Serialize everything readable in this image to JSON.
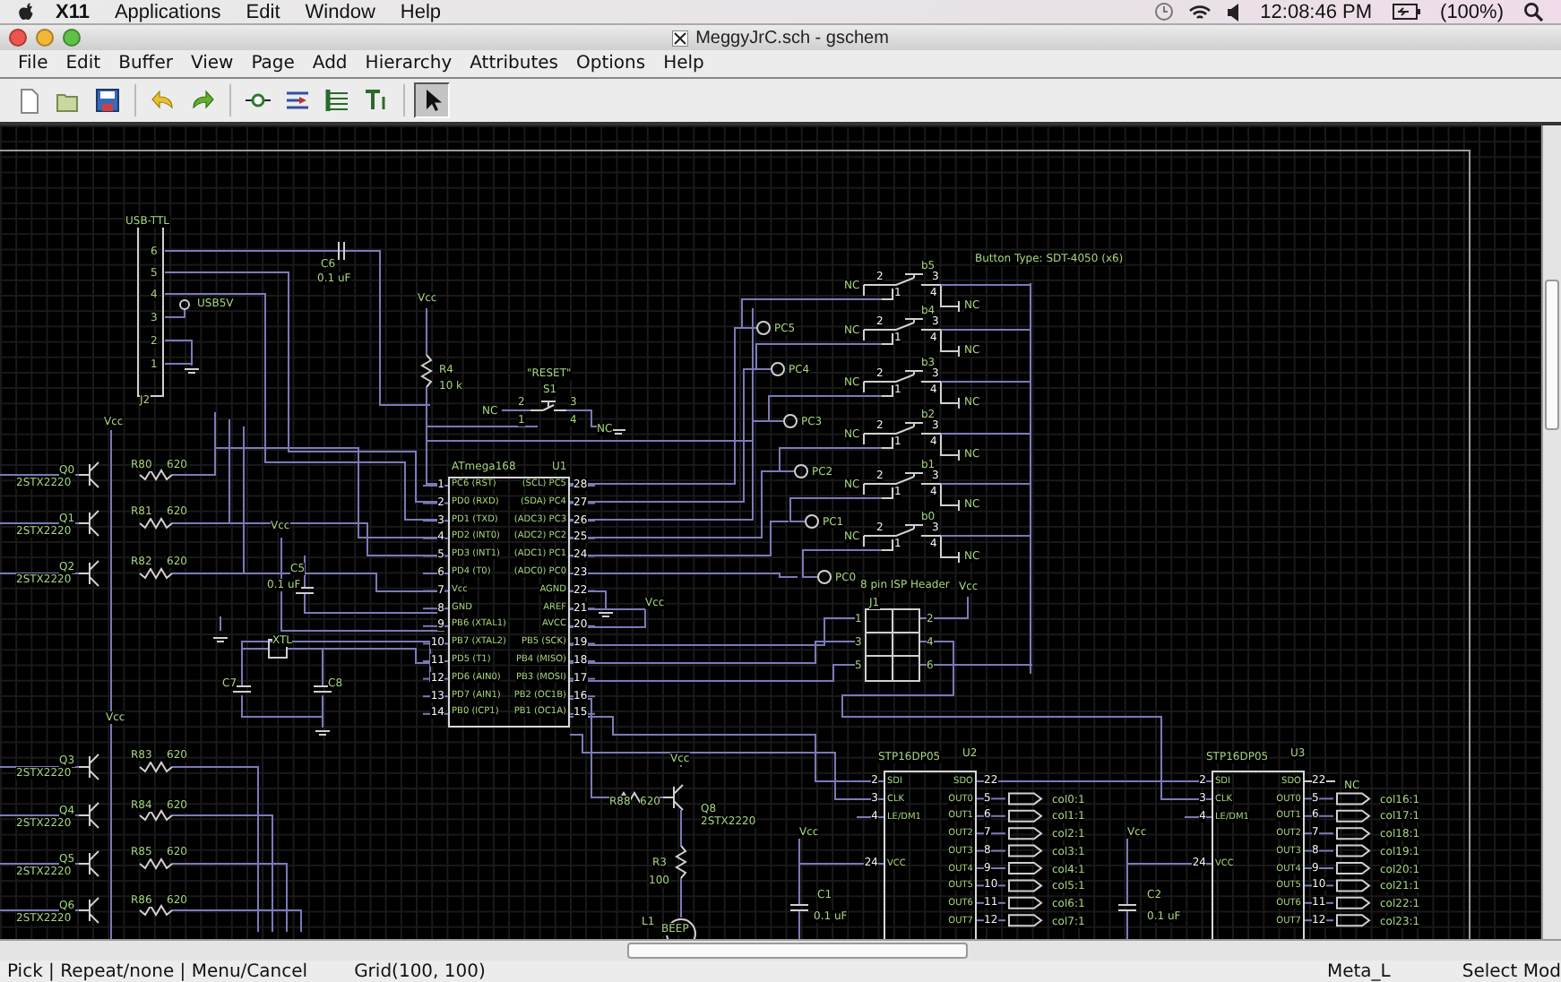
{
  "system_menubar": {
    "items": [
      "X11",
      "Applications",
      "Edit",
      "Window",
      "Help"
    ],
    "clock": "12:08:46 PM",
    "battery": "(100%)"
  },
  "window": {
    "title": "MeggyJrC.sch - gschem"
  },
  "menu": [
    "File",
    "Edit",
    "Buffer",
    "View",
    "Page",
    "Add",
    "Hierarchy",
    "Attributes",
    "Options",
    "Help"
  ],
  "toolbar": [
    {
      "kind": "new",
      "selected": false
    },
    {
      "kind": "open",
      "selected": false
    },
    {
      "kind": "save",
      "selected": false
    },
    {
      "kind": "sep"
    },
    {
      "kind": "undo",
      "selected": false
    },
    {
      "kind": "redo",
      "selected": false
    },
    {
      "kind": "sep"
    },
    {
      "kind": "component",
      "selected": false
    },
    {
      "kind": "net",
      "selected": false
    },
    {
      "kind": "bus",
      "selected": false
    },
    {
      "kind": "text",
      "selected": false
    },
    {
      "kind": "sep"
    },
    {
      "kind": "select",
      "selected": true
    }
  ],
  "schematic": {
    "labels": [
      "USB-TTL",
      "6",
      "5",
      "4",
      "3",
      "2",
      "1",
      "USB5V",
      "J2",
      "C6",
      "0.1 uF",
      "Vcc",
      "R4",
      "10 k",
      "\"RESET\"",
      "S1",
      "NC",
      "2",
      "3",
      "1",
      "4",
      "NC",
      "Vcc",
      "Q0",
      "2STX2220",
      "R80",
      "620",
      "Q1",
      "2STX2220",
      "R81",
      "620",
      "Q2",
      "2STX2220",
      "R82",
      "620",
      "Vcc",
      "C5",
      "0.1 uF",
      "XTL",
      "C7",
      "C8",
      "Vcc",
      "Q3",
      "2STX2220",
      "R83",
      "620",
      "Q4",
      "2STX2220",
      "R84",
      "620",
      "Q5",
      "2STX2220",
      "R85",
      "620",
      "Q6",
      "2STX2220",
      "R86",
      "620",
      "Vcc",
      "R88",
      "620",
      "Vcc",
      "Q8",
      "2STX2220",
      "R3",
      "100",
      "L1",
      "BEEP",
      "Button Type: SDT-4050 (x6)",
      "PC5",
      "PC4",
      "PC3",
      "PC2",
      "PC1",
      "PC0",
      "8 pin ISP Header",
      "J1",
      "Vcc",
      "1",
      "2",
      "3",
      "4",
      "5",
      "6",
      "NC",
      "Vcc",
      "C1",
      "0.1 uF",
      "Vcc",
      "C2",
      "0.1 uF"
    ],
    "switches": [
      {
        "ref": "b5",
        "pins": [
          "2",
          "1",
          "3",
          "4"
        ],
        "nc": [
          "NC",
          "NC"
        ]
      },
      {
        "ref": "b4",
        "pins": [
          "2",
          "1",
          "3",
          "4"
        ],
        "nc": [
          "NC",
          "NC"
        ]
      },
      {
        "ref": "b3",
        "pins": [
          "2",
          "1",
          "3",
          "4"
        ],
        "nc": [
          "NC",
          "NC"
        ]
      },
      {
        "ref": "b2",
        "pins": [
          "2",
          "1",
          "3",
          "4"
        ],
        "nc": [
          "NC",
          "NC"
        ]
      },
      {
        "ref": "b1",
        "pins": [
          "2",
          "1",
          "3",
          "4"
        ],
        "nc": [
          "NC",
          "NC"
        ]
      },
      {
        "ref": "b0",
        "pins": [
          "2",
          "1",
          "3",
          "4"
        ],
        "nc": [
          "NC",
          "NC"
        ]
      }
    ],
    "mcu": {
      "name": "ATmega168",
      "ref": "U1",
      "left_pins": [
        {
          "num": "1",
          "name": "PC6 (RST)"
        },
        {
          "num": "2",
          "name": "PD0 (RXD)"
        },
        {
          "num": "3",
          "name": "PD1 (TXD)"
        },
        {
          "num": "4",
          "name": "PD2 (INT0)"
        },
        {
          "num": "5",
          "name": "PD3 (INT1)"
        },
        {
          "num": "6",
          "name": "PD4 (T0)"
        },
        {
          "num": "7",
          "name": "Vcc"
        },
        {
          "num": "8",
          "name": "GND"
        },
        {
          "num": "9",
          "name": "PB6 (XTAL1)"
        },
        {
          "num": "10",
          "name": "PB7 (XTAL2)"
        },
        {
          "num": "11",
          "name": "PD5 (T1)"
        },
        {
          "num": "12",
          "name": "PD6 (AIN0)"
        },
        {
          "num": "13",
          "name": "PD7 (AIN1)"
        },
        {
          "num": "14",
          "name": "PB0 (ICP1)"
        }
      ],
      "right_pins": [
        {
          "num": "28",
          "name": "(SCL) PC5"
        },
        {
          "num": "27",
          "name": "(SDA) PC4"
        },
        {
          "num": "26",
          "name": "(ADC3) PC3"
        },
        {
          "num": "25",
          "name": "(ADC2) PC2"
        },
        {
          "num": "24",
          "name": "(ADC1) PC1"
        },
        {
          "num": "23",
          "name": "(ADC0) PC0"
        },
        {
          "num": "22",
          "name": "AGND"
        },
        {
          "num": "21",
          "name": "AREF"
        },
        {
          "num": "20",
          "name": "AVCC"
        },
        {
          "num": "19",
          "name": "PB5 (SCK)"
        },
        {
          "num": "18",
          "name": "PB4 (MISO)"
        },
        {
          "num": "17",
          "name": "PB3 (MOSI)"
        },
        {
          "num": "16",
          "name": "PB2 (OC1B)"
        },
        {
          "num": "15",
          "name": "PB1 (OC1A)"
        }
      ]
    },
    "drivers": [
      {
        "name": "STP16DP05",
        "ref": "U2",
        "left_pins": [
          {
            "num": "2",
            "name": "SDI"
          },
          {
            "num": "3",
            "name": "CLK"
          },
          {
            "num": "4",
            "name": "LE/DM1"
          },
          {
            "num": "24",
            "name": "VCC"
          }
        ],
        "right_pins": [
          {
            "num": "22",
            "name": "SDO"
          },
          {
            "num": "5",
            "name": "OUT0"
          },
          {
            "num": "6",
            "name": "OUT1"
          },
          {
            "num": "7",
            "name": "OUT2"
          },
          {
            "num": "8",
            "name": "OUT3"
          },
          {
            "num": "9",
            "name": "OUT4"
          },
          {
            "num": "10",
            "name": "OUT5"
          },
          {
            "num": "11",
            "name": "OUT6"
          },
          {
            "num": "12",
            "name": "OUT7"
          }
        ],
        "outputs": [
          "col0:1",
          "col1:1",
          "col2:1",
          "col3:1",
          "col4:1",
          "col5:1",
          "col6:1",
          "col7:1"
        ]
      },
      {
        "name": "STP16DP05",
        "ref": "U3",
        "left_pins": [
          {
            "num": "2",
            "name": "SDI"
          },
          {
            "num": "3",
            "name": "CLK"
          },
          {
            "num": "4",
            "name": "LE/DM1"
          },
          {
            "num": "24",
            "name": "VCC"
          }
        ],
        "right_pins": [
          {
            "num": "22",
            "name": "SDO"
          },
          {
            "num": "5",
            "name": "OUT0"
          },
          {
            "num": "6",
            "name": "OUT1"
          },
          {
            "num": "7",
            "name": "OUT2"
          },
          {
            "num": "8",
            "name": "OUT3"
          },
          {
            "num": "9",
            "name": "OUT4"
          },
          {
            "num": "10",
            "name": "OUT5"
          },
          {
            "num": "11",
            "name": "OUT6"
          },
          {
            "num": "12",
            "name": "OUT7"
          }
        ],
        "outputs": [
          "col16:1",
          "col17:1",
          "col18:1",
          "col19:1",
          "col20:1",
          "col21:1",
          "col22:1",
          "col23:1"
        ]
      }
    ]
  },
  "status_bar": {
    "hints": "Pick | Repeat/none | Menu/Cancel",
    "grid": "Grid(100, 100)",
    "key": "Meta_L",
    "mode": "Select Mod"
  }
}
